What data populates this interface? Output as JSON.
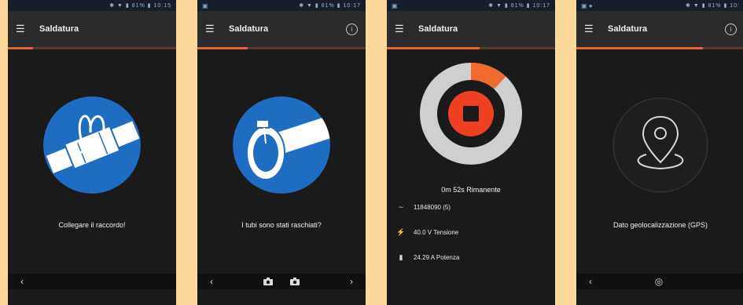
{
  "screens": [
    {
      "status": {
        "left": "",
        "right": "✱ ▼ ▮ 81% ▮ 10:15"
      },
      "app_title": "Saldatura",
      "progress": 0.15,
      "caption": "Collegare il raccordo!",
      "nav": {
        "back": "‹"
      }
    },
    {
      "status": {
        "left": "▣",
        "right": "✱ ▼ ▮ 81% ▮ 10:17"
      },
      "app_title": "Saldatura",
      "info": "i",
      "progress": 0.3,
      "caption": "I tubi sono stati raschiati?",
      "nav": {
        "back": "‹",
        "next": "›"
      }
    },
    {
      "status": {
        "left": "▣",
        "right": "✱ ▼ ▮ 81% ▮ 10:17"
      },
      "app_title": "Saldatura",
      "progress": 0.55,
      "remaining": "0m 52s Rimanente",
      "ring_progress": 0.12,
      "rows": [
        {
          "icon": "weld-icon",
          "text": "11848090 (5)"
        },
        {
          "icon": "bolt-icon",
          "text": "40.0 V Tensione"
        },
        {
          "icon": "power-icon",
          "text": "24.29 A Potenza"
        }
      ]
    },
    {
      "status": {
        "left": "▣ ●",
        "right": "✱ ▼ ▮ 81% ▮ 10:"
      },
      "app_title": "Saldatura",
      "info": "i",
      "progress": 0.75,
      "caption": "Dato geolocalizzazione (GPS)",
      "nav": {
        "back": "‹",
        "center": "◎"
      }
    }
  ]
}
